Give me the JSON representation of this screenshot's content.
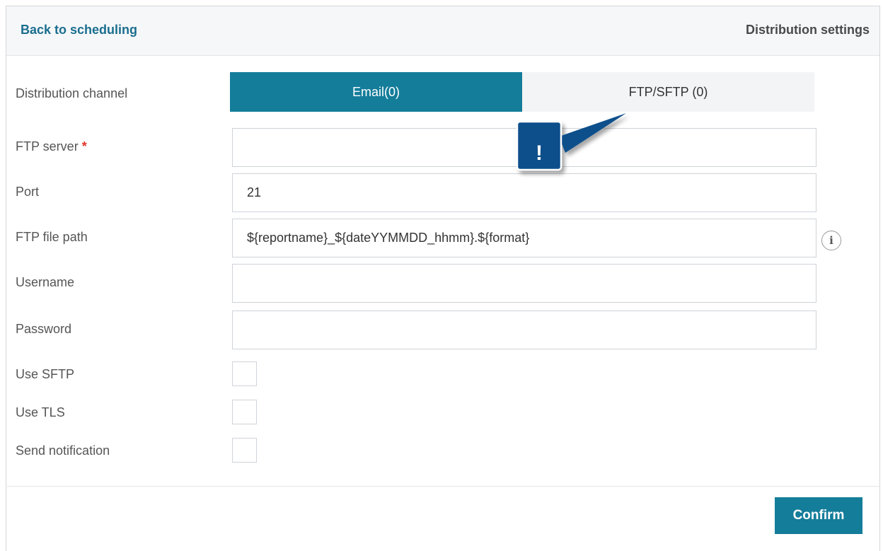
{
  "header": {
    "back_label": "Back to scheduling",
    "title": "Distribution settings"
  },
  "form": {
    "channel_label": "Distribution channel",
    "tabs": [
      {
        "label": "Email(0)",
        "active": true
      },
      {
        "label": "FTP/SFTP (0)",
        "active": false
      }
    ],
    "ftp_server": {
      "label": "FTP server",
      "required_mark": "*",
      "value": ""
    },
    "port": {
      "label": "Port",
      "value": "21"
    },
    "ftp_file_path": {
      "label": "FTP file path",
      "value": "${reportname}_${dateYYMMDD_hhmm}.${format}"
    },
    "username": {
      "label": "Username",
      "value": ""
    },
    "password": {
      "label": "Password",
      "value": ""
    },
    "use_sftp": {
      "label": "Use SFTP",
      "checked": false
    },
    "use_tls": {
      "label": "Use TLS",
      "checked": false
    },
    "send_notification": {
      "label": "Send notification",
      "checked": false
    }
  },
  "callout": {
    "text": "!",
    "color": "#0d4f8b"
  },
  "footer": {
    "confirm_label": "Confirm"
  },
  "colors": {
    "accent": "#147d9a",
    "link": "#1a6e8e",
    "required": "#e0352b"
  }
}
